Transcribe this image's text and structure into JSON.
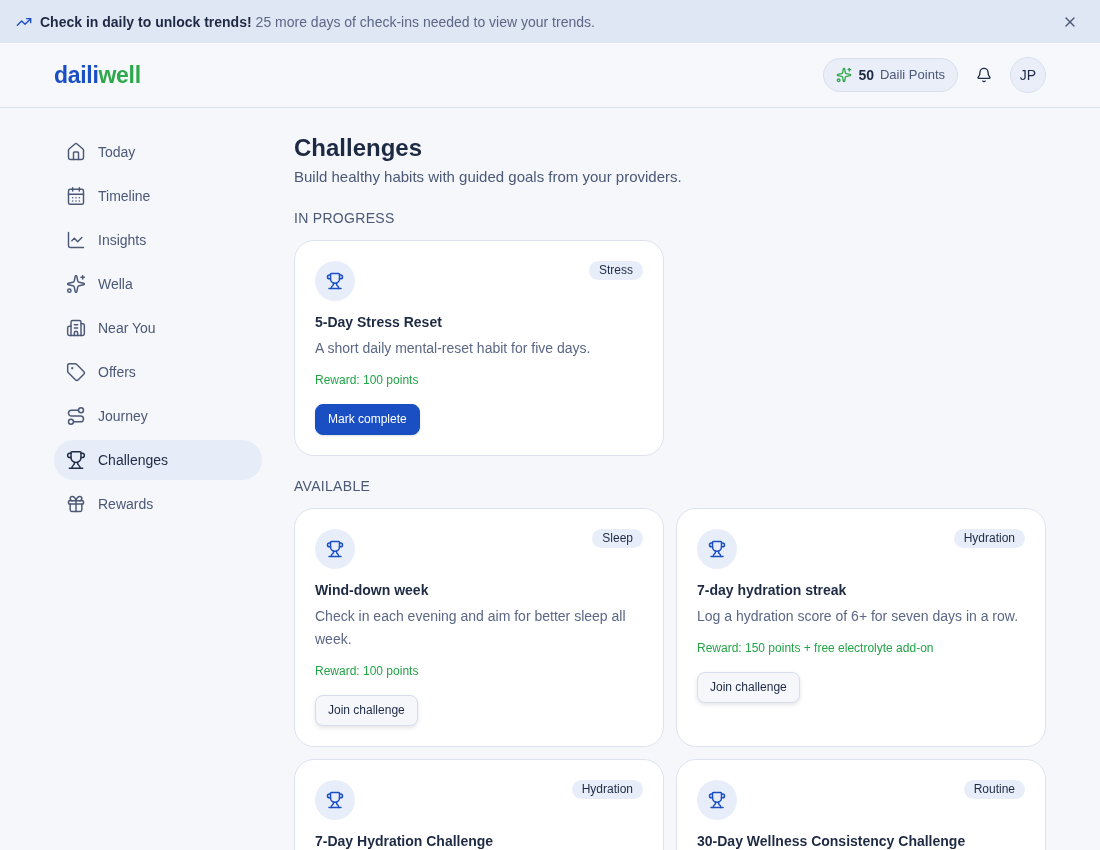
{
  "banner": {
    "title": "Check in daily to unlock trends!",
    "message": "25 more days of check-ins needed to view your trends."
  },
  "header": {
    "logo": [
      "daili",
      "well"
    ],
    "points": {
      "value": "50",
      "label": "Daili Points"
    },
    "avatar": "JP"
  },
  "sidebar": {
    "items": [
      {
        "label": "Today",
        "selected": false
      },
      {
        "label": "Timeline",
        "selected": false
      },
      {
        "label": "Insights",
        "selected": false
      },
      {
        "label": "Wella",
        "selected": false
      },
      {
        "label": "Near You",
        "selected": false
      },
      {
        "label": "Offers",
        "selected": false
      },
      {
        "label": "Journey",
        "selected": false
      },
      {
        "label": "Challenges",
        "selected": true
      },
      {
        "label": "Rewards",
        "selected": false
      }
    ]
  },
  "page": {
    "title": "Challenges",
    "subtitle": "Build healthy habits with guided goals from your providers."
  },
  "sections": [
    {
      "heading": "IN PROGRESS",
      "challenges": [
        {
          "tag": "Stress",
          "title": "5-Day Stress Reset",
          "description": "A short daily mental-reset habit for five days.",
          "reward": "Reward: 100 points",
          "action": {
            "label": "Mark complete",
            "kind": "primary"
          }
        }
      ]
    },
    {
      "heading": "AVAILABLE",
      "challenges": [
        {
          "tag": "Sleep",
          "title": "Wind-down week",
          "description": "Check in each evening and aim for better sleep all week.",
          "reward": "Reward: 100 points",
          "action": {
            "label": "Join challenge",
            "kind": "secondary"
          }
        },
        {
          "tag": "Hydration",
          "title": "7-day hydration streak",
          "description": "Log a hydration score of 6+ for seven days in a row.",
          "reward": "Reward: 150 points + free electrolyte add-on",
          "action": {
            "label": "Join challenge",
            "kind": "secondary"
          }
        },
        {
          "tag": "Hydration",
          "title": "7-Day Hydration Challenge"
        },
        {
          "tag": "Routine",
          "title": "30-Day Wellness Consistency Challenge"
        }
      ]
    }
  ]
}
